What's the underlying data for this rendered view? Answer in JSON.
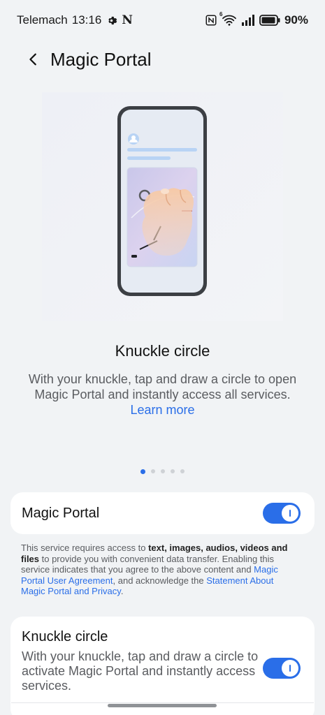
{
  "status_bar": {
    "carrier": "Telemach",
    "time": "13:16",
    "n_letter": "N",
    "wifi_badge": "6",
    "battery": "90%"
  },
  "header": {
    "title": "Magic Portal"
  },
  "feature": {
    "title": "Knuckle circle",
    "description": "With your knuckle, tap and draw a circle to open Magic Portal and instantly access all services.",
    "learn_more": "Learn more"
  },
  "pager": {
    "count": 5,
    "active_index": 0
  },
  "magic_portal_toggle": {
    "label": "Magic Portal",
    "enabled": true
  },
  "notice": {
    "part1": "This service requires access to ",
    "bold": "text, images, audios, videos and files",
    "part2": " to provide you with convenient data transfer. Enabling this service indicates that you agree to the above content and ",
    "link1": "Magic Portal User Agreement",
    "part3": ", and acknowledge the ",
    "link2": "Statement About Magic Portal and Privacy",
    "part4": "."
  },
  "knuckle_card": {
    "title": "Knuckle circle",
    "description": "With your knuckle, tap and draw a circle to activate Magic Portal and instantly access services.",
    "enabled": true
  },
  "colors": {
    "accent": "#2a6ee8",
    "background": "#f1f3f5",
    "card": "#ffffff"
  }
}
